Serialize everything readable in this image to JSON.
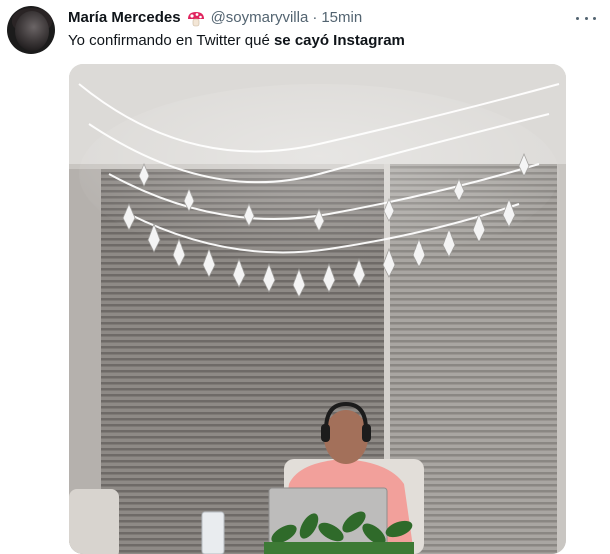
{
  "tweet": {
    "display_name": "María Mercedes",
    "handle": "@soymaryvilla",
    "separator": "·",
    "time": "15min",
    "text_prefix": "Yo confirmando en Twitter qué ",
    "text_bold": "se cayó Instagram",
    "author_badge_icon": "mushroom-icon",
    "more_icon": "more-options-icon",
    "media_icon": "video-media"
  },
  "colors": {
    "text_primary": "#0f1419",
    "text_secondary": "#536471",
    "badge_red": "#e0245e"
  }
}
